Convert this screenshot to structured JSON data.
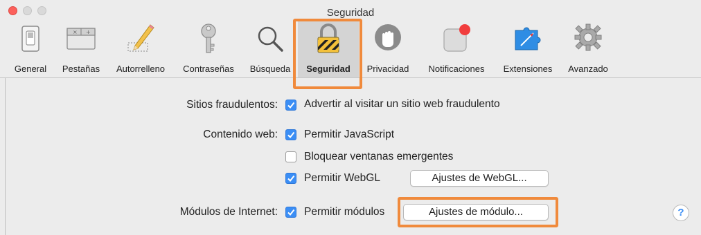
{
  "window": {
    "title": "Seguridad"
  },
  "toolbar": {
    "tabs": [
      {
        "label": "General",
        "icon": "general-switch-icon"
      },
      {
        "label": "Pestañas",
        "icon": "tabs-window-icon"
      },
      {
        "label": "Autorrelleno",
        "icon": "pencil-icon"
      },
      {
        "label": "Contraseñas",
        "icon": "key-icon"
      },
      {
        "label": "Búsqueda",
        "icon": "magnifier-icon"
      },
      {
        "label": "Seguridad",
        "icon": "padlock-icon",
        "selected": true
      },
      {
        "label": "Privacidad",
        "icon": "hand-icon"
      },
      {
        "label": "Notificaciones",
        "icon": "notification-badge-icon"
      },
      {
        "label": "Extensiones",
        "icon": "puzzle-icon"
      },
      {
        "label": "Avanzado",
        "icon": "gear-icon"
      }
    ]
  },
  "security": {
    "fraud": {
      "label": "Sitios fraudulentos:",
      "option": "Advertir al visitar un sitio web fraudulento",
      "checked": true
    },
    "web_content": {
      "label": "Contenido web:",
      "javascript": {
        "text": "Permitir JavaScript",
        "checked": true
      },
      "popups": {
        "text": "Bloquear ventanas emergentes",
        "checked": false
      },
      "webgl": {
        "text": "Permitir WebGL",
        "checked": true
      },
      "webgl_button": "Ajustes de WebGL..."
    },
    "plugins": {
      "label": "Módulos de Internet:",
      "option": "Permitir módulos",
      "checked": true,
      "button": "Ajustes de módulo..."
    }
  },
  "help": {
    "label": "?"
  },
  "colors": {
    "highlight": "#f08a3c",
    "checkbox_accent": "#3b8ef5",
    "close_button": "#fc605b"
  }
}
